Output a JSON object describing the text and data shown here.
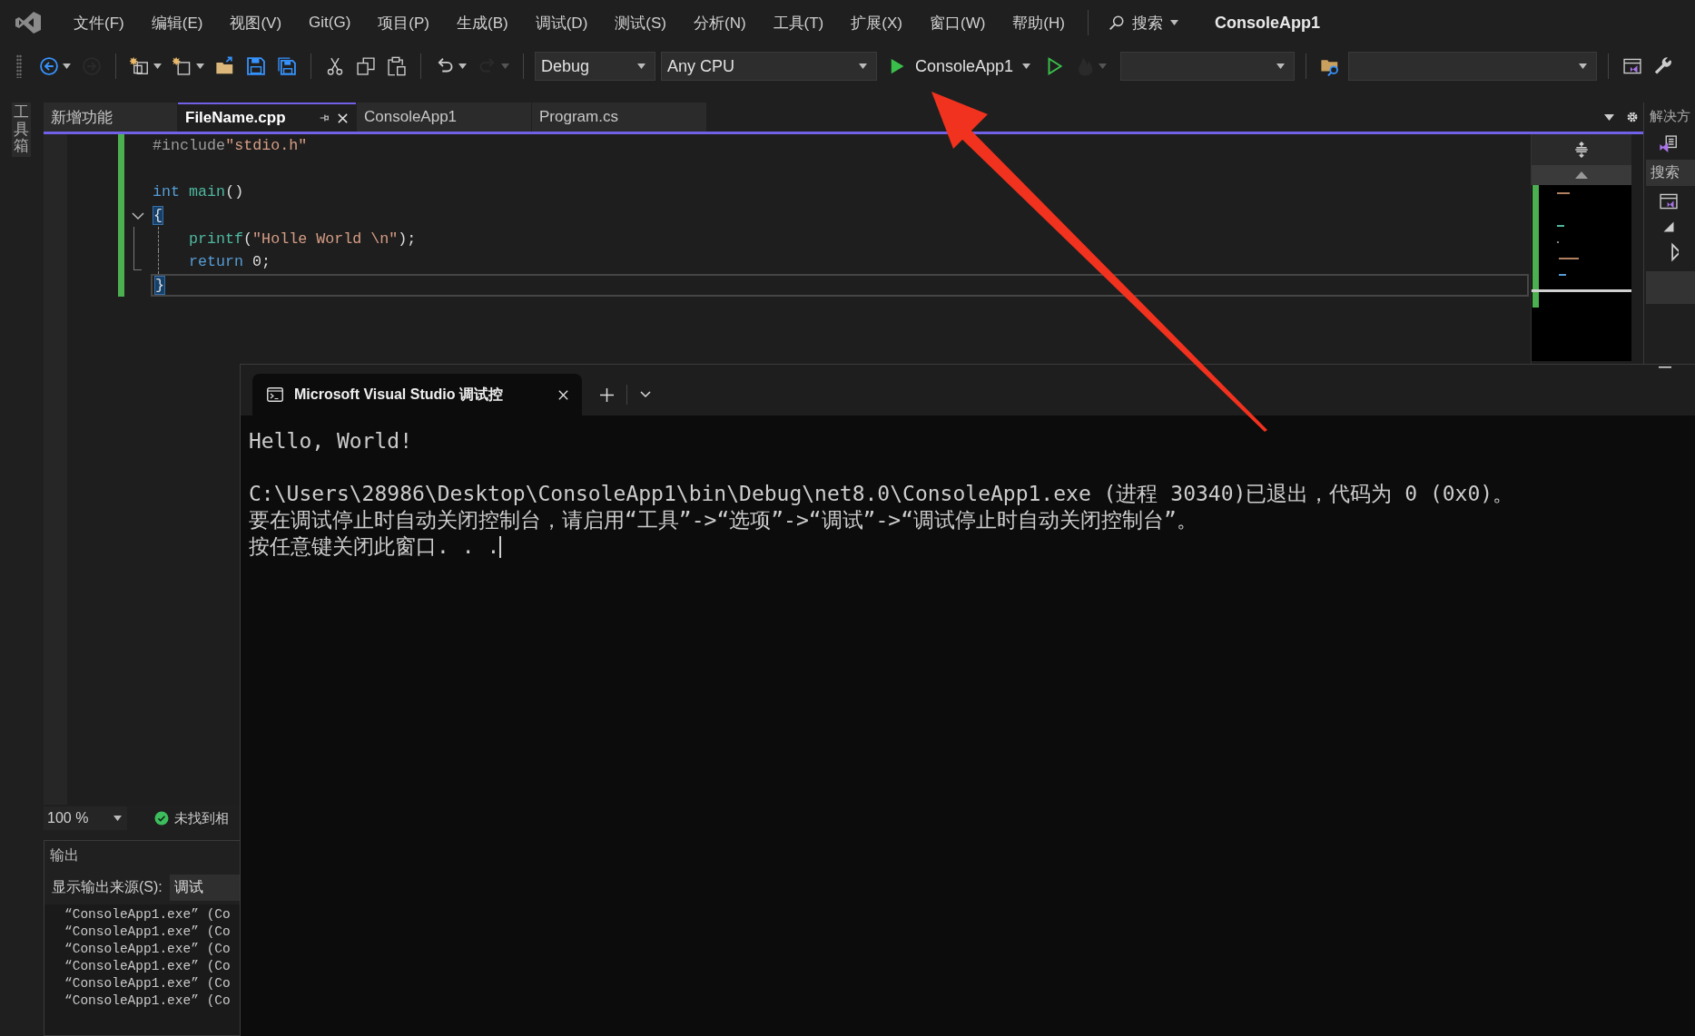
{
  "menu_bar": {
    "items": [
      "文件(F)",
      "编辑(E)",
      "视图(V)",
      "Git(G)",
      "项目(P)",
      "生成(B)",
      "调试(D)",
      "测试(S)",
      "分析(N)",
      "工具(T)",
      "扩展(X)",
      "窗口(W)",
      "帮助(H)"
    ],
    "search": "搜索",
    "solution_name": "ConsoleApp1"
  },
  "toolbar": [
    {
      "kind": "back",
      "disabled": false,
      "menu": true
    },
    {
      "kind": "forward",
      "disabled": true,
      "menu": false
    },
    {
      "kind": "separator"
    },
    {
      "kind": "new-project",
      "disabled": false,
      "menu": true
    },
    {
      "kind": "add-item",
      "disabled": false,
      "menu": true
    },
    {
      "kind": "open-folder",
      "disabled": false,
      "menu": false
    },
    {
      "kind": "save",
      "disabled": false,
      "menu": false
    },
    {
      "kind": "save-all",
      "disabled": false,
      "menu": false
    },
    {
      "kind": "separator"
    },
    {
      "kind": "cut",
      "disabled": false,
      "menu": false
    },
    {
      "kind": "copy",
      "disabled": false,
      "menu": false
    },
    {
      "kind": "paste",
      "disabled": false,
      "menu": false
    },
    {
      "kind": "separator"
    },
    {
      "kind": "undo",
      "disabled": false,
      "menu": true
    },
    {
      "kind": "redo",
      "disabled": true,
      "menu": true
    },
    {
      "kind": "separator"
    },
    {
      "kind": "dropdown",
      "value": "Debug"
    },
    {
      "kind": "dropdown",
      "value": "Any CPU"
    },
    {
      "kind": "run",
      "label": "ConsoleApp1"
    },
    {
      "kind": "run-outline",
      "disabled": false,
      "menu": false
    },
    {
      "kind": "hot-reload",
      "disabled": true,
      "menu": true
    },
    {
      "kind": "dropdown"
    },
    {
      "kind": "separator"
    },
    {
      "kind": "find-folder",
      "disabled": false,
      "menu": false
    },
    {
      "kind": "dropdown"
    },
    {
      "kind": "separator"
    },
    {
      "kind": "window",
      "disabled": false,
      "menu": false
    },
    {
      "kind": "wrench",
      "disabled": false,
      "menu": false
    }
  ],
  "side_strip": {
    "label": "工具箱"
  },
  "editor_tabs": [
    {
      "label": "新增功能",
      "selected": false
    },
    {
      "label": "FileName.cpp",
      "selected": true
    },
    {
      "label": "ConsoleApp1",
      "selected": false
    },
    {
      "label": "Program.cs",
      "selected": false
    }
  ],
  "code_lines": [
    {
      "kind": "code",
      "changed": true,
      "current": false,
      "tokens": [
        {
          "kind": "preprocessor",
          "text": "#include"
        },
        {
          "kind": "string",
          "text": "\"stdio.h\""
        }
      ]
    },
    {
      "kind": "blank",
      "changed": true
    },
    {
      "kind": "code",
      "changed": true,
      "current": false,
      "tokens": [
        {
          "kind": "keyword",
          "text": "int "
        },
        {
          "kind": "function",
          "text": "main"
        },
        {
          "kind": "plain",
          "text": "()"
        }
      ]
    },
    {
      "kind": "code",
      "changed": true,
      "current": false,
      "expanded": true,
      "tokens": [
        {
          "kind": "brace_match",
          "text": "{"
        }
      ],
      "children": [
        {
          "kind": "code",
          "changed": true,
          "current": false,
          "tokens": [
            {
              "kind": "function",
              "text": "printf"
            },
            {
              "kind": "plain",
              "text": "("
            },
            {
              "kind": "string",
              "text": "\"Holle World \\n\""
            },
            {
              "kind": "plain",
              "text": ");"
            }
          ]
        },
        {
          "kind": "code",
          "changed": true,
          "current": false,
          "tokens": [
            {
              "kind": "keyword",
              "text": "return "
            },
            {
              "kind": "plain",
              "text": "0;"
            }
          ]
        }
      ]
    },
    {
      "kind": "code",
      "changed": true,
      "current": true,
      "tokens": [
        {
          "kind": "brace_match",
          "text": "}"
        }
      ]
    }
  ],
  "editor_status": {
    "zoom": "100 %",
    "issues": "未找到相"
  },
  "output": {
    "title": "输出",
    "source_label": "显示输出来源(S):",
    "source": "调试",
    "lines": [
      "“ConsoleApp1.exe” (Co",
      "“ConsoleApp1.exe” (Co",
      "“ConsoleApp1.exe” (Co",
      "“ConsoleApp1.exe” (Co",
      "“ConsoleApp1.exe” (Co",
      "“ConsoleApp1.exe” (Co"
    ]
  },
  "solution_explorer": {
    "title": "解决方",
    "search": "搜索"
  },
  "console": {
    "tab_title": "Microsoft Visual Studio 调试控",
    "lines": [
      {
        "kind": "text",
        "text": "Hello, World!",
        "cursor": false
      },
      {
        "kind": "blank"
      },
      {
        "kind": "text",
        "text": "C:\\Users\\28986\\Desktop\\ConsoleApp1\\bin\\Debug\\net8.0\\ConsoleApp1.exe (进程 30340)已退出，代码为 0 (0x0)。",
        "cursor": false
      },
      {
        "kind": "text",
        "text": "要在调试停止时自动关闭控制台，请启用“工具”->“选项”->“调试”->“调试停止时自动关闭控制台”。",
        "cursor": false
      },
      {
        "kind": "text",
        "text": "按任意键关闭此窗口. . .",
        "cursor": true
      }
    ]
  },
  "annotation": {
    "kind": "arrow"
  }
}
